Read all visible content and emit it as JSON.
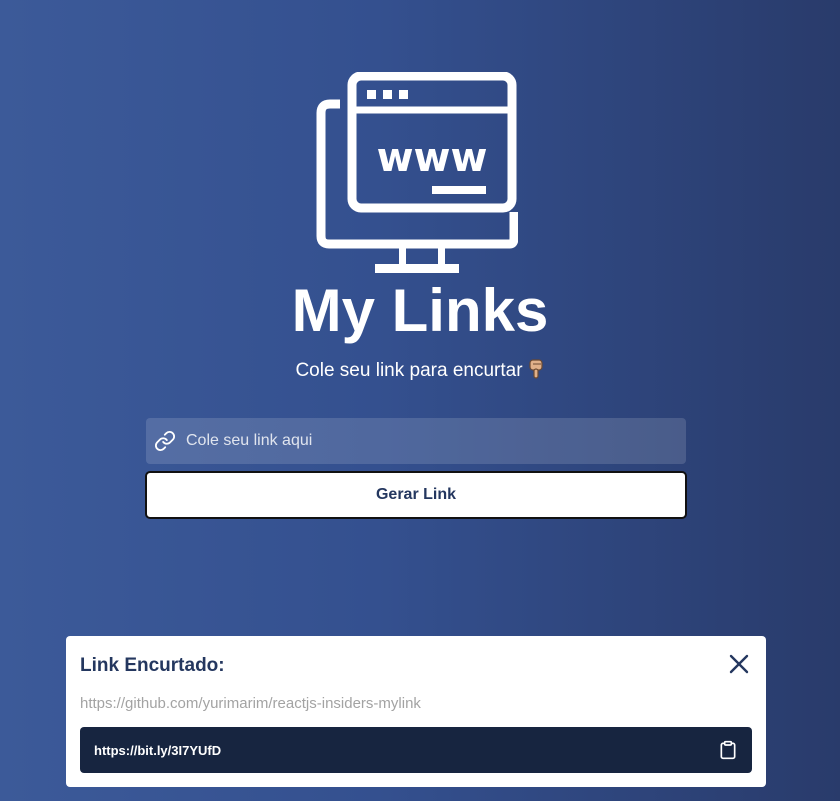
{
  "app": {
    "title": "My Links",
    "subtitle": "Cole seu link para encurtar",
    "subtitle_emoji": "pointing-down-hand-icon",
    "logo_icon": "www-monitor-icon"
  },
  "form": {
    "input_placeholder": "Cole seu link aqui",
    "input_value": "",
    "input_icon": "link-icon",
    "submit_label": "Gerar Link"
  },
  "modal": {
    "title": "Link Encurtado:",
    "original_url": "https://github.com/yurimarim/reactjs-insiders-mylink",
    "short_url": "https://bit.ly/3I7YUfD",
    "close_icon": "close-icon",
    "copy_icon": "clipboard-icon"
  },
  "colors": {
    "background_start": "#3c5a99",
    "background_end": "#293b6b",
    "accent_dark": "#24375f",
    "short_box": "#172540",
    "white": "#ffffff"
  }
}
